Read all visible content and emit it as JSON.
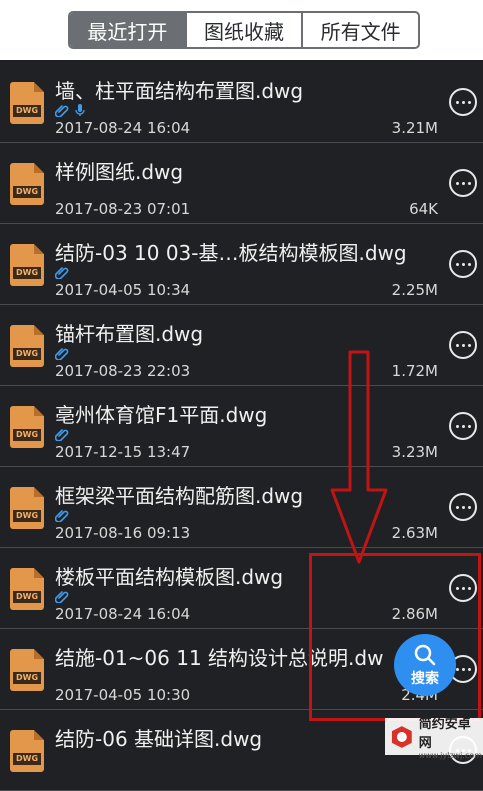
{
  "tabs": [
    {
      "label": "最近打开",
      "active": true
    },
    {
      "label": "图纸收藏",
      "active": false
    },
    {
      "label": "所有文件",
      "active": false
    }
  ],
  "file_icon_badge": "DWG",
  "files": [
    {
      "name": "墙、柱平面结构布置图.dwg",
      "date": "2017-08-24 16:04",
      "size": "3.21M",
      "tags": [
        "paperclip-icon",
        "audio-icon"
      ]
    },
    {
      "name": "样例图纸.dwg",
      "date": "2017-08-23 07:01",
      "size": "64K",
      "tags": []
    },
    {
      "name": "结防-03 10 03-基…板结构模板图.dwg",
      "date": "2017-04-05 10:34",
      "size": "2.25M",
      "tags": [
        "paperclip-icon"
      ]
    },
    {
      "name": "锚杆布置图.dwg",
      "date": "2017-08-23 22:03",
      "size": "1.72M",
      "tags": [
        "paperclip-icon"
      ]
    },
    {
      "name": "亳州体育馆F1平面.dwg",
      "date": "2017-12-15 13:47",
      "size": "3.23M",
      "tags": [
        "paperclip-icon"
      ]
    },
    {
      "name": "框架梁平面结构配筋图.dwg",
      "date": "2017-08-16 09:13",
      "size": "2.63M",
      "tags": [
        "paperclip-icon"
      ]
    },
    {
      "name": "楼板平面结构模板图.dwg",
      "date": "2017-08-24 16:04",
      "size": "2.86M",
      "tags": [
        "paperclip-icon"
      ]
    },
    {
      "name": "结施-01~06 11 结构设计总说明.dw",
      "date": "2017-04-05 10:30",
      "size": "2.4M",
      "tags": []
    },
    {
      "name": "结防-06 基础详图.dwg",
      "date": "",
      "size": "",
      "tags": []
    }
  ],
  "search_fab": {
    "label": "搜索"
  },
  "watermark": {
    "title": "简约安卓网",
    "url": "www.jylzwj.com"
  },
  "colors": {
    "accent": "#2f8ff0",
    "annotation": "#c21414",
    "file_icon": "#e3974a"
  }
}
